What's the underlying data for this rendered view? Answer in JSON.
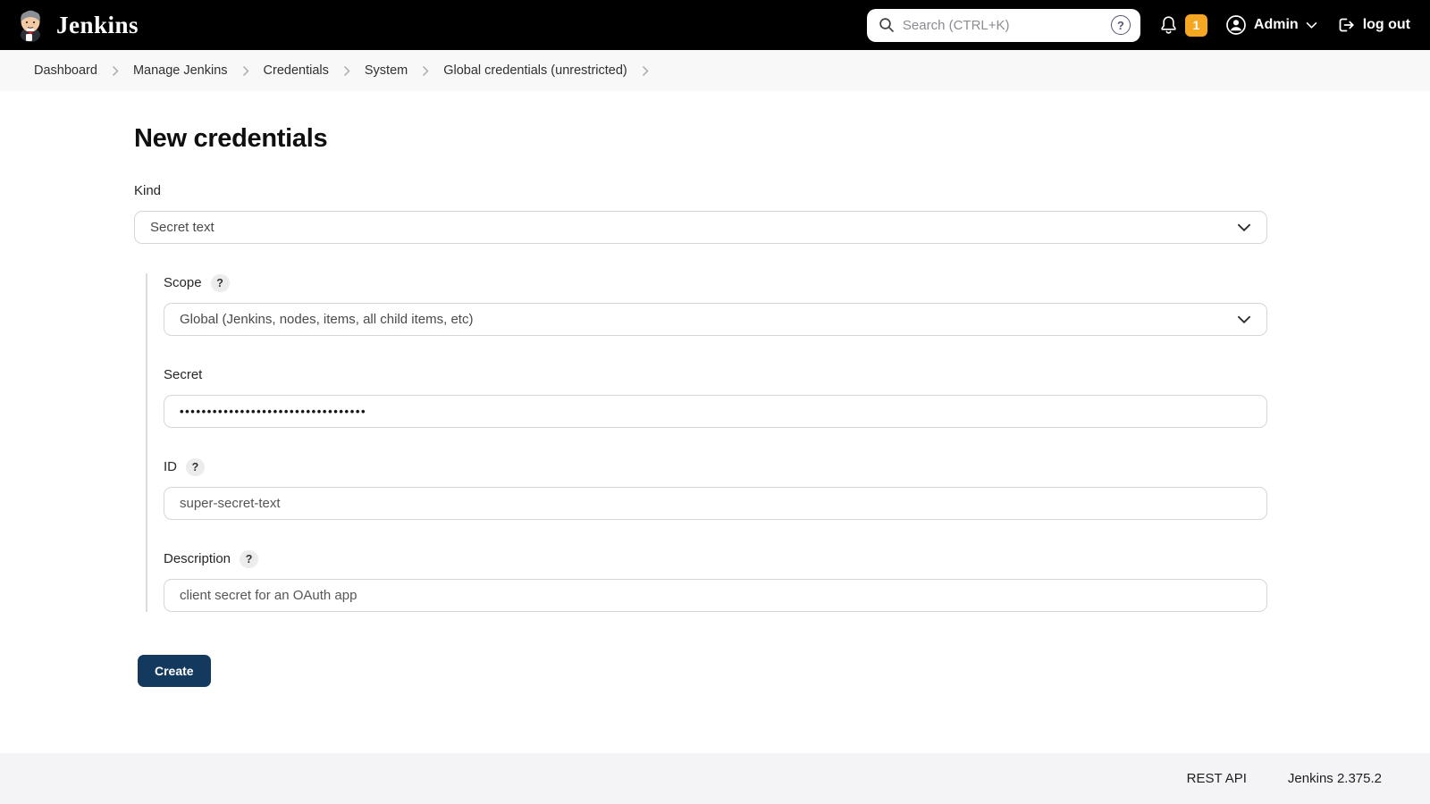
{
  "header": {
    "brand": "Jenkins",
    "search": {
      "placeholder": "Search (CTRL+K)"
    },
    "notification_count": "1",
    "user_name": "Admin",
    "logout_label": "log out"
  },
  "breadcrumb": {
    "items": [
      "Dashboard",
      "Manage Jenkins",
      "Credentials",
      "System",
      "Global credentials (unrestricted)"
    ]
  },
  "page": {
    "title": "New credentials",
    "help_glyph": "?",
    "fields": {
      "kind": {
        "label": "Kind",
        "value": "Secret text"
      },
      "scope": {
        "label": "Scope",
        "value": "Global (Jenkins, nodes, items, all child items, etc)"
      },
      "secret": {
        "label": "Secret",
        "value": "••••••••••••••••••••••••••••••••••"
      },
      "id": {
        "label": "ID",
        "value": "super-secret-text"
      },
      "description": {
        "label": "Description",
        "value": "client secret for an OAuth app"
      }
    },
    "create_label": "Create"
  },
  "footer": {
    "rest_api": "REST API",
    "version": "Jenkins 2.375.2"
  },
  "icons": {
    "help_glyph": "?",
    "names": [
      "jenkins-butler-logo",
      "search-icon",
      "help-circle-icon",
      "bell-icon",
      "user-circle-icon",
      "chevron-down-icon",
      "logout-icon",
      "breadcrumb-chevron-icon",
      "select-chevron-icon"
    ]
  },
  "colors": {
    "header_bg": "#000000",
    "badge_orange": "#f5a623",
    "primary_button": "#133a5e",
    "breadcrumb_bg": "#f8f8f9",
    "footer_bg": "#f4f4f6"
  }
}
